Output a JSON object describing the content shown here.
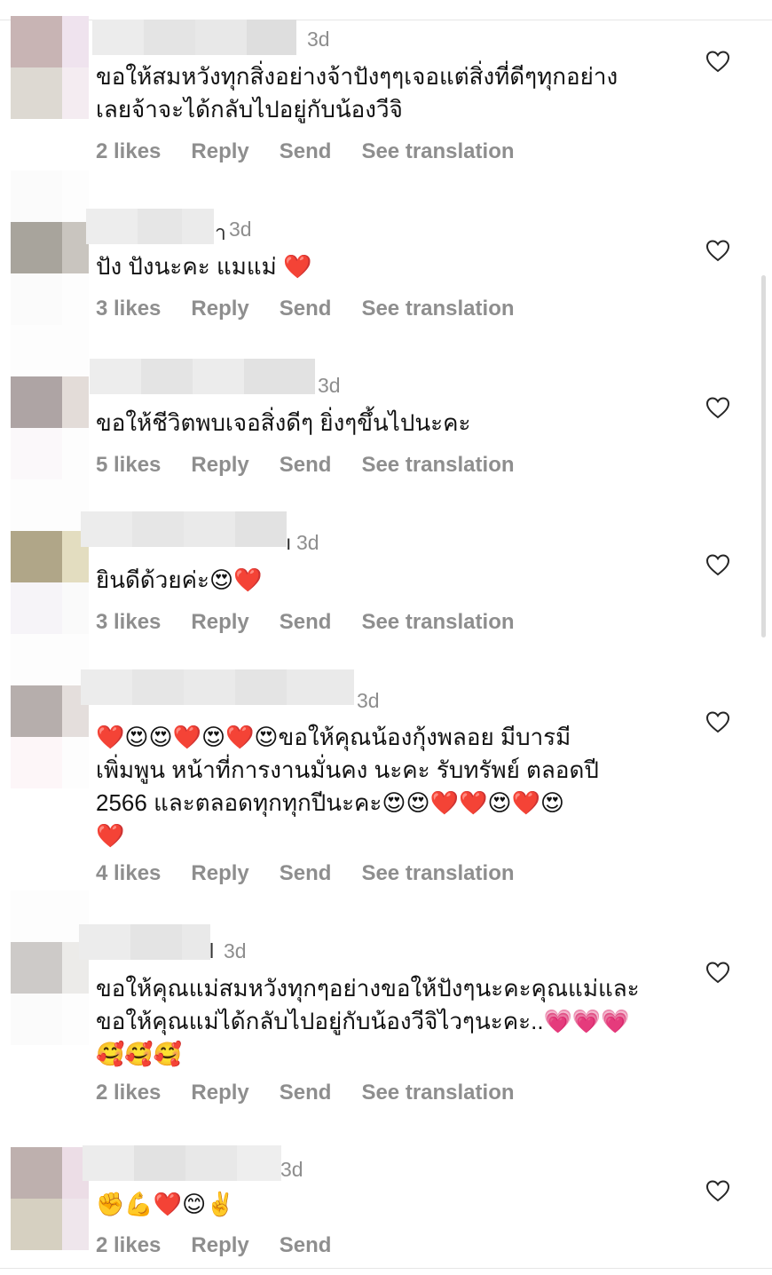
{
  "ui": {
    "heart_icon": "heart-outline-icon",
    "colors": {
      "muted": "#8e8e8e",
      "text": "#121212",
      "divider": "#e6e6e6"
    }
  },
  "comments": [
    {
      "time": "3d",
      "text": "ขอให้สมหวังทุกสิ่งอย่างจ้าปังๆๆเจอแต่สิ่งที่ดีๆทุกอย่าง\nเลยจ้าจะได้กลับไปอยู่กับน้องวีจิ",
      "likes": "2 likes",
      "reply": "Reply",
      "send": "Send",
      "translate": "See translation"
    },
    {
      "time": "3d",
      "name_tail": "า",
      "text": "ปัง ปังนะคะ แมแม่ ❤️",
      "likes": "3 likes",
      "reply": "Reply",
      "send": "Send",
      "translate": "See translation"
    },
    {
      "time": "3d",
      "text": "ขอให้ชีวิตพบเจอสิ่งดีๆ ยิ่งๆขึ้นไปนะคะ",
      "likes": "5 likes",
      "reply": "Reply",
      "send": "Send",
      "translate": "See translation"
    },
    {
      "time": "3d",
      "name_tail": "ı",
      "text": "ยินดีด้วยค่ะ😍❤️",
      "likes": "3 likes",
      "reply": "Reply",
      "send": "Send",
      "translate": "See translation"
    },
    {
      "time": "3d",
      "text": "❤️😍😍❤️😍❤️😍ขอให้คุณน้องกุ้งพลอย มีบารมี\nเพิ่มพูน หน้าที่การงานมั่นคง นะคะ รับทรัพย์ ตลอดปี\n2566 และตลอดทุกทุกปีนะคะ😍😍❤️❤️😍❤️😍\n❤️",
      "likes": "4 likes",
      "reply": "Reply",
      "send": "Send",
      "translate": "See translation"
    },
    {
      "time": "3d",
      "name_tail": "l",
      "text": "ขอให้คุณแม่สมหวังทุกๆอย่างขอให้ปังๆนะคะคุณแม่และ\nขอให้คุณแม่ได้กลับไปอยู่กับน้องวีจิไวๆนะคะ..💗💗💗\n🥰🥰🥰",
      "likes": "2 likes",
      "reply": "Reply",
      "send": "Send",
      "translate": "See translation"
    },
    {
      "time": "3d",
      "text": "✊💪❤️😊✌️",
      "likes": "2 likes",
      "reply": "Reply",
      "send": "Send"
    }
  ]
}
